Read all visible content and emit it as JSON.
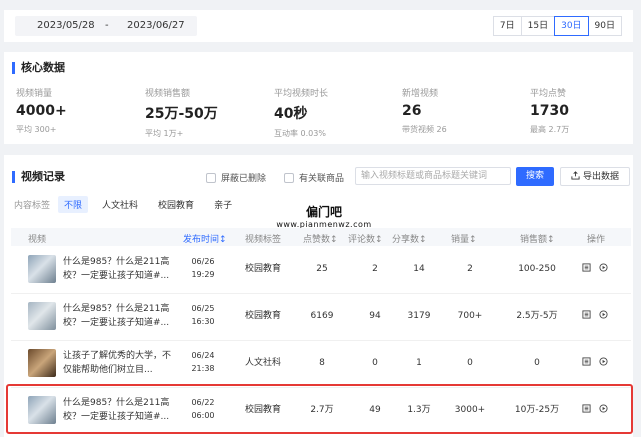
{
  "date_bar": {
    "start": "2023/05/28",
    "separator": "-",
    "end": "2023/06/27",
    "periods": [
      "7日",
      "15日",
      "30日",
      "90日"
    ],
    "active_period": "30日"
  },
  "core": {
    "title": "核心数据",
    "metrics": [
      {
        "label": "视频销量",
        "value": "4000+",
        "sub": "平均 300+"
      },
      {
        "label": "视频销售额",
        "value": "25万-50万",
        "sub": "平均 1万+"
      },
      {
        "label": "平均视频时长",
        "value": "40秒",
        "sub": "互动率 0.03%"
      },
      {
        "label": "新增视频",
        "value": "26",
        "sub": "带货视频 26"
      },
      {
        "label": "平均点赞",
        "value": "1730",
        "sub": "最高 2.7万"
      }
    ]
  },
  "records": {
    "title": "视频记录",
    "checkbox_hide_deleted": "屏蔽已删除",
    "checkbox_related": "有关联商品",
    "search_placeholder": "输入视频标题或商品标题关键词",
    "search_label": "搜索",
    "export_label": "导出数据",
    "tag_label": "内容标签",
    "tags": [
      "不限",
      "人文社科",
      "校园教育",
      "亲子"
    ],
    "watermark_cn": "偏门吧",
    "watermark_url": "www.pianmenwz.com",
    "columns": [
      "视频",
      "发布时间↕",
      "视频标签",
      "点赞数↕",
      "评论数↕",
      "分享数↕",
      "销量↕",
      "销售额↕",
      "操作"
    ],
    "rows": [
      {
        "title": "什么是985？什么是211高校？一定要让孩子知道#...",
        "date": "06/26",
        "time": "19:29",
        "tag": "校园教育",
        "likes": "25",
        "comments": "2",
        "shares": "14",
        "sales": "2",
        "revenue": "100-250"
      },
      {
        "title": "什么是985？什么是211高校？一定要让孩子知道#...",
        "date": "06/25",
        "time": "16:30",
        "tag": "校园教育",
        "likes": "6169",
        "comments": "94",
        "shares": "3179",
        "sales": "700+",
        "revenue": "2.5万-5万"
      },
      {
        "title": "让孩子了解优秀的大学，不仅能帮助他们树立目...",
        "date": "06/24",
        "time": "21:38",
        "tag": "人文社科",
        "likes": "8",
        "comments": "0",
        "shares": "1",
        "sales": "0",
        "revenue": "0"
      },
      {
        "title": "什么是985？什么是211高校？一定要让孩子知道#...",
        "date": "06/22",
        "time": "06:00",
        "tag": "校园教育",
        "likes": "2.7万",
        "comments": "49",
        "shares": "1.3万",
        "sales": "3000+",
        "revenue": "10万-25万"
      }
    ]
  },
  "colors": {
    "accent": "#2f6bff",
    "highlight": "#e53935"
  }
}
